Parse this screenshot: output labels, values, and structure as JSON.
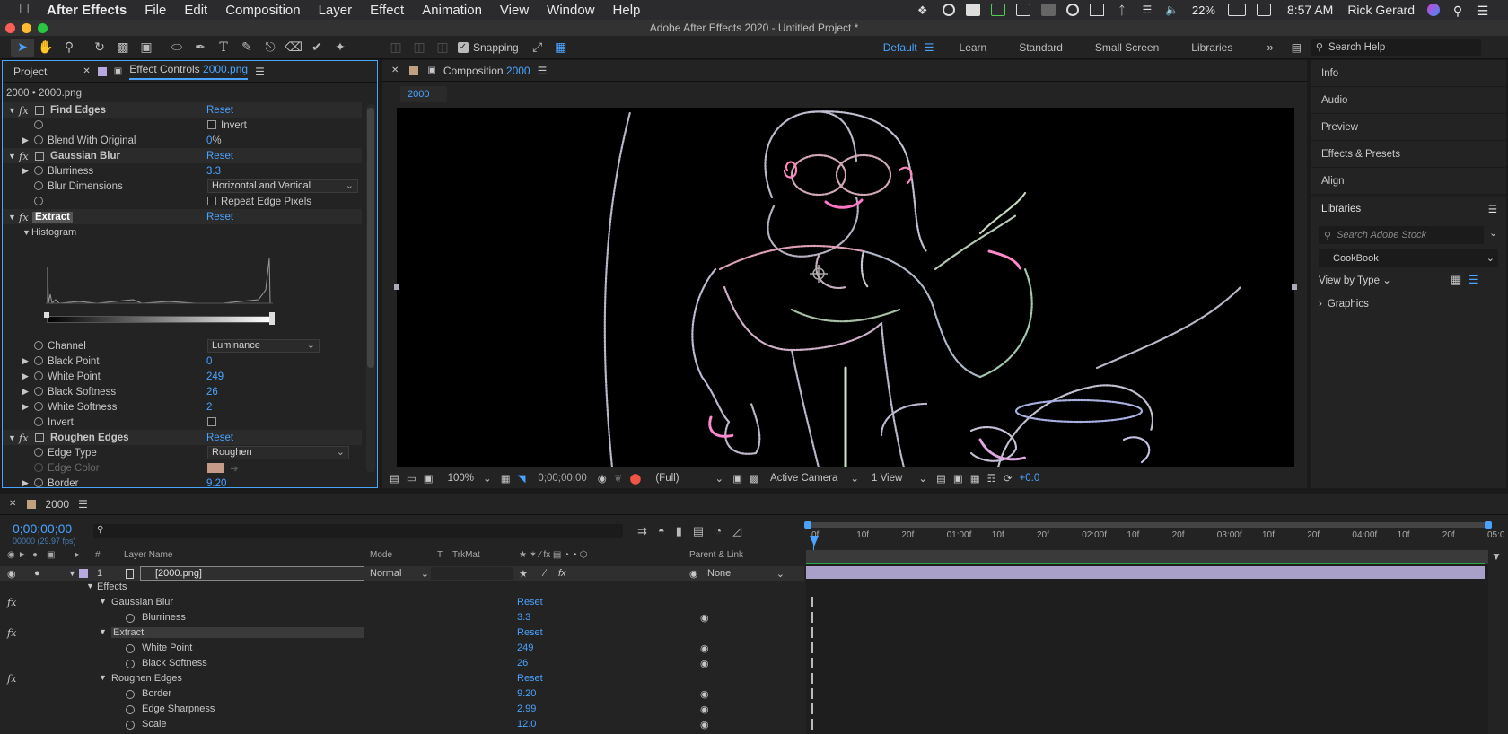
{
  "menubar": {
    "app": "After Effects",
    "items": [
      "File",
      "Edit",
      "Composition",
      "Layer",
      "Effect",
      "Animation",
      "View",
      "Window",
      "Help"
    ],
    "battery": "22%",
    "time": "8:57 AM",
    "user": "Rick Gerard"
  },
  "window": {
    "title": "Adobe After Effects 2020 - Untitled Project *"
  },
  "toolbar": {
    "snapping": "Snapping",
    "workspaces": [
      "Default",
      "Learn",
      "Standard",
      "Small Screen",
      "Libraries"
    ],
    "search": "Search Help"
  },
  "effects_panel": {
    "tab_project": "Project",
    "tab_effect": "Effect Controls",
    "tab_effect_file": "2000.png",
    "subtitle": "2000 • 2000.png",
    "find_edges": {
      "name": "Find Edges",
      "reset": "Reset",
      "invert": "Invert",
      "blend_label": "Blend With Original",
      "blend_value": "0",
      "blend_unit": "%"
    },
    "gaussian": {
      "name": "Gaussian Blur",
      "reset": "Reset",
      "blurriness_label": "Blurriness",
      "blurriness_value": "3.3",
      "dims_label": "Blur Dimensions",
      "dims_value": "Horizontal and Vertical",
      "repeat": "Repeat Edge Pixels"
    },
    "extract": {
      "name": "Extract",
      "reset": "Reset",
      "histogram": "Histogram",
      "channel_label": "Channel",
      "channel_value": "Luminance",
      "black_point_label": "Black Point",
      "black_point": "0",
      "white_point_label": "White Point",
      "white_point": "249",
      "black_soft_label": "Black Softness",
      "black_soft": "26",
      "white_soft_label": "White Softness",
      "white_soft": "2",
      "invert": "Invert"
    },
    "roughen": {
      "name": "Roughen Edges",
      "reset": "Reset",
      "edge_type_label": "Edge Type",
      "edge_type": "Roughen",
      "edge_color_label": "Edge Color",
      "border_label": "Border",
      "border": "9.20"
    }
  },
  "comp_panel": {
    "tab_label": "Composition",
    "tab_name": "2000",
    "flow": "2000",
    "zoom": "100%",
    "timecode": "0;00;00;00",
    "resolution": "(Full)",
    "camera": "Active Camera",
    "views": "1 View",
    "exposure": "+0.0"
  },
  "right_panel": {
    "items": [
      "Info",
      "Audio",
      "Preview",
      "Effects & Presets",
      "Align"
    ],
    "libraries": "Libraries",
    "stock_placeholder": "Search Adobe Stock",
    "library": "CookBook",
    "view_by": "View by Type",
    "graphics": "Graphics"
  },
  "timeline": {
    "tab": "2000",
    "timecode": "0;00;00;00",
    "fps": "00000 (29.97 fps)",
    "cols": {
      "num": "#",
      "name": "Layer Name",
      "mode": "Mode",
      "t": "T",
      "trkmat": "TrkMat",
      "parent": "Parent & Link"
    },
    "ruler": [
      "0f",
      "10f",
      "20f",
      "01:00f",
      "10f",
      "20f",
      "02:00f",
      "10f",
      "20f",
      "03:00f",
      "10f",
      "20f",
      "04:00f",
      "10f",
      "20f",
      "05:0"
    ],
    "layer": {
      "num": "1",
      "name": "[2000.png]",
      "mode": "Normal",
      "parent": "None"
    },
    "effects_label": "Effects",
    "reset": "Reset",
    "props": [
      {
        "fx": "Gaussian Blur",
        "children": [
          {
            "label": "Blurriness",
            "value": "3.3"
          }
        ]
      },
      {
        "fx": "Extract",
        "children": [
          {
            "label": "White Point",
            "value": "249"
          },
          {
            "label": "Black Softness",
            "value": "26"
          }
        ]
      },
      {
        "fx": "Roughen Edges",
        "children": [
          {
            "label": "Border",
            "value": "9.20"
          },
          {
            "label": "Edge Sharpness",
            "value": "2.99"
          },
          {
            "label": "Scale",
            "value": "12.0"
          }
        ]
      }
    ]
  }
}
